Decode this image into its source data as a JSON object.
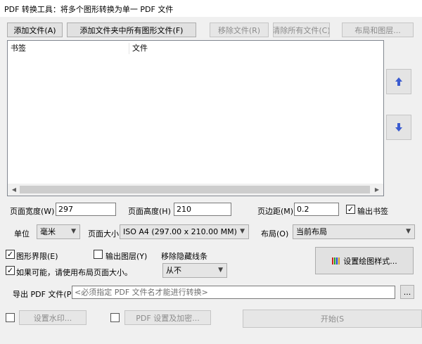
{
  "window": {
    "title": "PDF 转换工具：将多个图形转换为单一 PDF 文件"
  },
  "toolbar": {
    "add_file": "添加文件(A)",
    "add_folder": "添加文件夹中所有图形文件(F)",
    "remove_file": "移除文件(R)",
    "clear_all": "清除所有文件(C)",
    "layout_layers": "布局和图层..."
  },
  "file_list": {
    "columns": [
      "书签",
      "文件"
    ],
    "rows": []
  },
  "settings": {
    "page_width_label": "页面宽度(W)",
    "page_width_value": "297",
    "page_height_label": "页面高度(H)",
    "page_height_value": "210",
    "margin_label": "页边距(M)",
    "margin_value": "0.2",
    "output_bookmarks_label": "输出书签",
    "unit_label": "单位",
    "unit_value": "毫米",
    "page_size_label": "页面大小",
    "page_size_value": "ISO A4 (297.00 x 210.00 MM)",
    "layout_label": "布局(O)",
    "layout_value": "当前布局",
    "limits_label": "图形界限(E)",
    "output_layers_label": "输出图层(Y)",
    "hidden_lines_label": "移除隐藏线条",
    "hidden_lines_value": "从不",
    "use_layout_size_label": "如果可能，请使用布局页面大小。",
    "plot_style_button": "设置绘图样式..."
  },
  "export": {
    "label": "导出 PDF 文件(P)",
    "placeholder": "<必须指定 PDF 文件名才能进行转换>",
    "browse": "..."
  },
  "footer": {
    "watermark": "设置水印...",
    "pdf_settings": "PDF 设置及加密...",
    "start": "开始(S"
  },
  "colors": {
    "up_arrow": "#3a5bd0",
    "down_arrow": "#3a5bd0",
    "disabled_text": "#8c8c8c"
  }
}
